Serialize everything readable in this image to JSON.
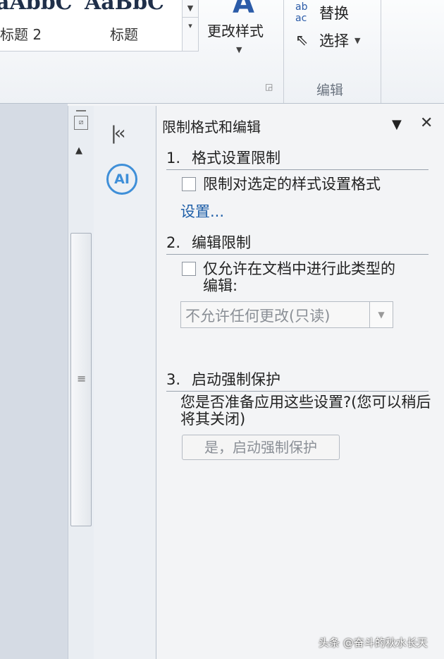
{
  "ribbon": {
    "styles": [
      {
        "sample": "aAbbC",
        "name": "标题 2"
      },
      {
        "sample": "AaBbC",
        "name": "标题"
      }
    ],
    "change_style_label": "更改样式",
    "edit_group": {
      "replace_label": "替换",
      "replace_icon": "ab-ac-replace-icon",
      "select_label": "选择",
      "select_icon": "cursor-arrow-icon",
      "group_label": "编辑"
    }
  },
  "side_strip": {
    "collapse_icon": "double-chevron-left-icon",
    "ai_label": "AI"
  },
  "pane": {
    "title": "限制格式和编辑",
    "section1": {
      "num": "1.",
      "title": "格式设置限制",
      "checkbox_label": "限制对选定的样式设置格式",
      "checked": false,
      "link": "设置..."
    },
    "section2": {
      "num": "2.",
      "title": "编辑限制",
      "checkbox_label_line1": "仅允许在文档中进行此类型的",
      "checkbox_label_line2": "编辑:",
      "checked": false,
      "select_value": "不允许任何更改(只读)"
    },
    "section3": {
      "num": "3.",
      "title": "启动强制保护",
      "prompt": "您是否准备应用这些设置?(您可以稍后将其关闭)",
      "button": "是，启动强制保护"
    }
  },
  "watermark": "头条 @奋斗的秋水长天",
  "colors": {
    "accent": "#2b5ba8",
    "link": "#1f5fa8",
    "ai": "#3f8fd8",
    "pane_bg": "#f3f4f6"
  }
}
